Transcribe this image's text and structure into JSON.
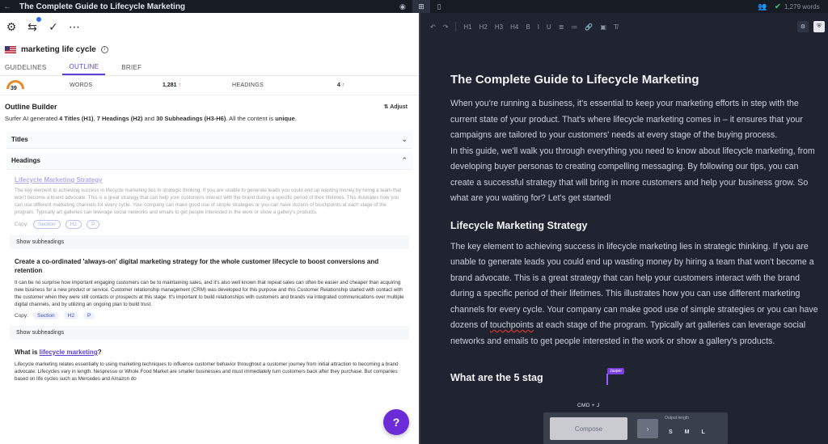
{
  "window": {
    "title": "The Complete Guide to Lifecycle Marketing",
    "word_count": "1,279 words"
  },
  "keyword": {
    "text": "marketing life cycle",
    "flag": "us-flag-icon"
  },
  "tabs": [
    "GUIDELINES",
    "OUTLINE",
    "BRIEF"
  ],
  "stats": {
    "score": "39",
    "words_label": "WORDS",
    "words_value": "1,281",
    "headings_label": "HEADINGS",
    "headings_value": "4",
    "trend": "↑"
  },
  "outline": {
    "title": "Outline Builder",
    "adjust": "Adjust",
    "desc_pre": "Surfer AI generated ",
    "desc_titles": "4 Titles (H1)",
    "desc_mid1": ", ",
    "desc_headings": "7 Headings (H2)",
    "desc_mid2": " and ",
    "desc_subs": "30 Subheadings (H3-H6)",
    "desc_post": ". All the content is ",
    "desc_unique": "unique",
    "desc_end": ".",
    "sections": [
      "Titles",
      "Headings"
    ],
    "copy_label": "Copy:",
    "copy_pills": [
      "Section",
      "H2",
      "P"
    ],
    "show_sub": "Show subheadings",
    "card1_heading": "Lifecycle Marketing Strategy",
    "card1_text": "The key element to achieving success in lifecycle marketing lies in strategic thinking. If you are unable to generate leads you could end up wasting money by hiring a team that won't become a brand advocate. This is a great strategy that can help your customers interact with the brand during a specific period of their lifetimes. This illustrates how you can use different marketing channels for every cycle. Your company can make good use of simple strategies or you can have dozens of touchpoints at each stage of the program. Typically art galleries can leverage social networks and emails to get people interested in the work or show a gallery's products.",
    "card2_heading": "Create a co-ordinated 'always-on' digital marketing strategy for the whole customer lifecycle to boost conversions and retention",
    "card2_text": "It can be no surprise how important engaging customers can be to maintaining sales, and it's also well known that repeat sales can often be easier and cheaper than acquiring new business for a new product or service. Customer relationship management (CRM) was developed for this purpose and this Customer Relationship started with contact with the customer when they were still contacts or prospects at this stage. It's important to build relationships with customers and brands via integrated communications over multiple digital channels, and by utilizing an ongoing plan to build trust.",
    "card3_heading_pre": "What is ",
    "card3_heading_link": "lifecycle marketing",
    "card3_heading_post": "?",
    "card3_text": "Lifecycle marketing relates essentially to using marketing techniques to influence customer behavior throughout a customer journey from initial attraction to becoming a brand advocate. Lifecycles vary in length. Nespresso or Whole Food Market are smaller businesses and must immediately turn customers back after they purchase. But companies based on life cycles such as Mercedes and Amazon do"
  },
  "editor": {
    "toolbar": [
      "↶",
      "↷",
      "H1",
      "H2",
      "H3",
      "H4",
      "B",
      "I",
      "U",
      "≣",
      "≔",
      "🔗",
      "▣",
      "T̸"
    ],
    "h1": "The Complete Guide to Lifecycle Marketing",
    "intro": "When you're running a business, it's essential to keep your marketing efforts in step with the current state of your product. That's where lifecycle marketing comes in – it ensures that your campaigns are tailored to your customers' needs at every stage of the buying process.",
    "intro2": "In this guide, we'll walk you through everything you need to know about lifecycle marketing, from developing buyer personas to creating compelling messaging. By following our tips, you can create a successful strategy that will bring in more customers and help your business grow. So what are you waiting for? Let's get started!",
    "h2a": "Lifecycle Marketing Strategy",
    "para_a1": "The key element to achieving success in lifecycle marketing lies in strategic thinking. If you are unable to generate leads you could end up wasting money by hiring a team that won't become a brand advocate. This is a great strategy that can help your customers interact with the brand during a specific period of their lifetimes. This illustrates how you can use different marketing channels for every cycle. Your company can make good use of simple strategies or you can have dozens of ",
    "para_a_sq": "touchpoints",
    "para_a2": " at each stage of the program. Typically art galleries can leverage social networks and emails to get people interested in the work or show a gallery's products.",
    "h2b": "What are the 5 stag",
    "jasper": "Jasper",
    "cmd": "CMD + J",
    "compose": "Compose",
    "output_length": "Output length",
    "sizes": [
      "S",
      "M",
      "L"
    ]
  }
}
